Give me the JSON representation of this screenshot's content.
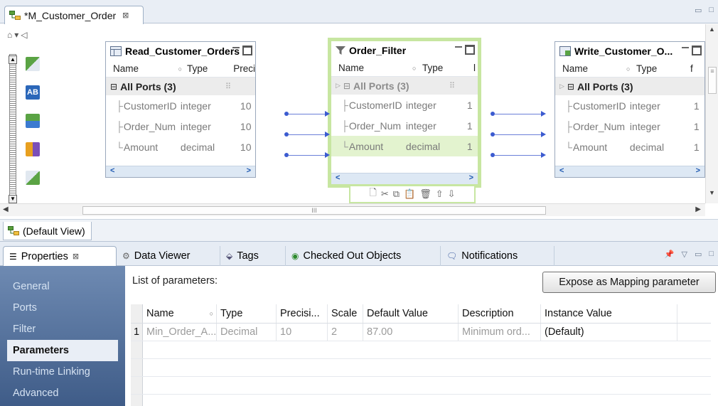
{
  "editor": {
    "tab_title": "*M_Customer_Order",
    "close_glyph": "⊠",
    "minimize_glyph": "▭",
    "maximize_glyph": "□"
  },
  "canvas": {
    "objects": [
      {
        "id": "read",
        "title": "Read_Customer_Orders",
        "icon": "source-table-icon",
        "columns": {
          "name": "Name",
          "type": "Type",
          "extra": "Preci"
        },
        "group": "All Ports (3)",
        "ports": [
          {
            "name": "CustomerID",
            "type": "integer",
            "precision": "10"
          },
          {
            "name": "Order_Num",
            "type": "integer",
            "precision": "10"
          },
          {
            "name": "Amount",
            "type": "decimal",
            "precision": "10"
          }
        ]
      },
      {
        "id": "filter",
        "title": "Order_Filter",
        "icon": "funnel-icon",
        "columns": {
          "name": "Name",
          "type": "Type",
          "extra": "l"
        },
        "group": "All Ports (3)",
        "ports": [
          {
            "name": "CustomerID",
            "type": "integer",
            "precision": "1"
          },
          {
            "name": "Order_Num",
            "type": "integer",
            "precision": "1"
          },
          {
            "name": "Amount",
            "type": "decimal",
            "precision": "1"
          }
        ]
      },
      {
        "id": "write",
        "title": "Write_Customer_O...",
        "icon": "target-table-icon",
        "columns": {
          "name": "Name",
          "type": "Type",
          "extra": "f"
        },
        "group": "All Ports (3)",
        "ports": [
          {
            "name": "CustomerID",
            "type": "integer",
            "precision": "1"
          },
          {
            "name": "Order_Num",
            "type": "integer",
            "precision": "1"
          },
          {
            "name": "Amount",
            "type": "decimal",
            "precision": "1"
          }
        ]
      }
    ],
    "hscroll_grip": "III",
    "vscroll_grip": "≡"
  },
  "view_tab": {
    "label": "(Default View)"
  },
  "props": {
    "tabs": [
      {
        "label": "Properties",
        "icon": "properties-icon",
        "active": true
      },
      {
        "label": "Data Viewer",
        "icon": "data-viewer-icon"
      },
      {
        "label": "Tags",
        "icon": "tag-icon"
      },
      {
        "label": "Checked Out Objects",
        "icon": "checked-out-icon"
      },
      {
        "label": "Notifications",
        "icon": "notifications-icon"
      }
    ],
    "nav": [
      "General",
      "Ports",
      "Filter",
      "Parameters",
      "Run-time Linking",
      "Advanced"
    ],
    "nav_active": "Parameters",
    "list_label": "List of parameters:",
    "expose_button": "Expose as Mapping parameter",
    "table": {
      "headers": [
        "Name",
        "Type",
        "Precisi...",
        "Scale",
        "Default Value",
        "Description",
        "Instance Value"
      ],
      "rows": [
        [
          "1",
          "Min_Order_A...",
          "Decimal",
          "10",
          "2",
          "87.00",
          "Minimum ord...",
          "(Default)"
        ]
      ]
    }
  },
  "colors": {
    "filter_border": "#c7e6a1",
    "wire": "#3b5bd0",
    "nav_bg": "#4f6c98"
  }
}
